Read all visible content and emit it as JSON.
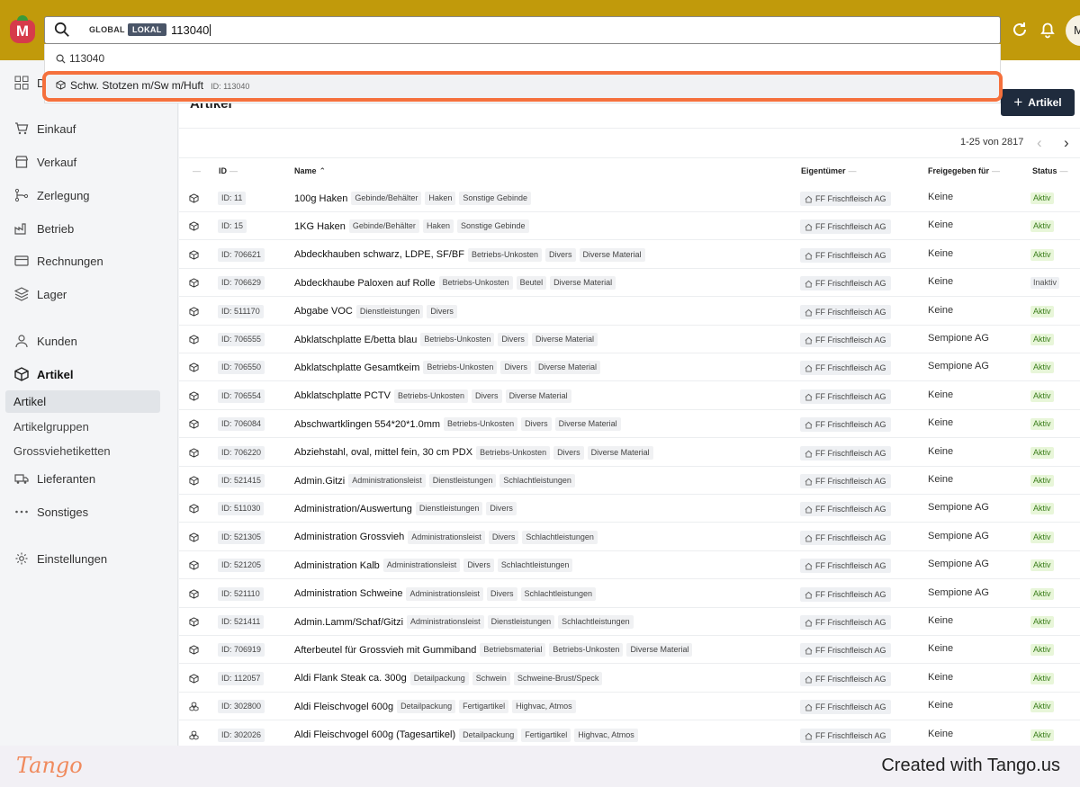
{
  "app": {
    "logo_letter": "M"
  },
  "search": {
    "scope_global": "GLOBAL",
    "scope_lokal": "LOKAL",
    "value": "113040"
  },
  "dropdown": {
    "query_suggestion": "113040",
    "result_name": "Schw. Stotzen m/Sw m/Huft",
    "result_id": "ID: 113040"
  },
  "header": {
    "avatar_initial": "M"
  },
  "sidebar": {
    "partial_top_label": "D",
    "items": [
      {
        "label": "Einkauf",
        "icon": "cart-icon"
      },
      {
        "label": "Verkauf",
        "icon": "store-icon"
      },
      {
        "label": "Zerlegung",
        "icon": "split-icon"
      },
      {
        "label": "Betrieb",
        "icon": "factory-icon"
      },
      {
        "label": "Rechnungen",
        "icon": "invoice-icon"
      },
      {
        "label": "Lager",
        "icon": "stack-icon"
      },
      {
        "label": "Kunden",
        "icon": "person-icon"
      },
      {
        "label": "Artikel",
        "icon": "cube-icon"
      }
    ],
    "sub_items": [
      "Artikel",
      "Artikelgruppen",
      "Grossvieh­etiketten",
      "Lieferanten"
    ],
    "lieferanten": "Lieferanten",
    "sonstiges": "Sonstiges",
    "einstellungen": "Einstellungen"
  },
  "main": {
    "title": "Artikel",
    "add_button": "Artikel",
    "pagination": "1-25 von 2817",
    "columns": {
      "id": "ID",
      "name": "Name",
      "owner": "Eigentümer",
      "released": "Freigegeben für",
      "status": "Status"
    },
    "rows": [
      {
        "id": "ID: 11",
        "name": "100g Haken",
        "tags": [
          "Gebinde/Behälter",
          "Haken",
          "Sonstige Gebinde"
        ],
        "owner": "FF Frischfleisch AG",
        "released": "Keine",
        "status": "Aktiv"
      },
      {
        "id": "ID: 15",
        "name": "1KG Haken",
        "tags": [
          "Gebinde/Behälter",
          "Haken",
          "Sonstige Gebinde"
        ],
        "owner": "FF Frischfleisch AG",
        "released": "Keine",
        "status": "Aktiv"
      },
      {
        "id": "ID: 706621",
        "name": "Abdeckhauben schwarz, LDPE, SF/BF",
        "tags": [
          "Betriebs-Unkosten",
          "Divers",
          "Diverse Material"
        ],
        "owner": "FF Frischfleisch AG",
        "released": "Keine",
        "status": "Aktiv"
      },
      {
        "id": "ID: 706629",
        "name": "Abdeckhaube Paloxen auf Rolle",
        "tags": [
          "Betriebs-Unkosten",
          "Beutel",
          "Diverse Material"
        ],
        "owner": "FF Frischfleisch AG",
        "released": "Keine",
        "status": "Inaktiv"
      },
      {
        "id": "ID: 511170",
        "name": "Abgabe VOC",
        "tags": [
          "Dienstleistungen",
          "Divers"
        ],
        "owner": "FF Frischfleisch AG",
        "released": "Keine",
        "status": "Aktiv"
      },
      {
        "id": "ID: 706555",
        "name": "Abklatschplatte E/betta blau",
        "tags": [
          "Betriebs-Unkosten",
          "Divers",
          "Diverse Material"
        ],
        "owner": "FF Frischfleisch AG",
        "released": "Sempione AG",
        "status": "Aktiv"
      },
      {
        "id": "ID: 706550",
        "name": "Abklatschplatte Gesamtkeim",
        "tags": [
          "Betriebs-Unkosten",
          "Divers",
          "Diverse Material"
        ],
        "owner": "FF Frischfleisch AG",
        "released": "Sempione AG",
        "status": "Aktiv"
      },
      {
        "id": "ID: 706554",
        "name": "Abklatschplatte PCTV",
        "tags": [
          "Betriebs-Unkosten",
          "Divers",
          "Diverse Material"
        ],
        "owner": "FF Frischfleisch AG",
        "released": "Keine",
        "status": "Aktiv"
      },
      {
        "id": "ID: 706084",
        "name": "Abschwartklingen 554*20*1.0mm",
        "tags": [
          "Betriebs-Unkosten",
          "Divers",
          "Diverse Material"
        ],
        "owner": "FF Frischfleisch AG",
        "released": "Keine",
        "status": "Aktiv"
      },
      {
        "id": "ID: 706220",
        "name": "Abziehstahl, oval, mittel fein, 30 cm PDX",
        "tags": [
          "Betriebs-Unkosten",
          "Divers",
          "Diverse Material"
        ],
        "owner": "FF Frischfleisch AG",
        "released": "Keine",
        "status": "Aktiv"
      },
      {
        "id": "ID: 521415",
        "name": "Admin.Gitzi",
        "tags": [
          "Administrationsleist",
          "Dienstleistungen",
          "Schlachtleistungen"
        ],
        "owner": "FF Frischfleisch AG",
        "released": "Keine",
        "status": "Aktiv"
      },
      {
        "id": "ID: 511030",
        "name": "Administration/Auswertung",
        "tags": [
          "Dienstleistungen",
          "Divers"
        ],
        "owner": "FF Frischfleisch AG",
        "released": "Sempione AG",
        "status": "Aktiv"
      },
      {
        "id": "ID: 521305",
        "name": "Administration Grossvieh",
        "tags": [
          "Administrationsleist",
          "Divers",
          "Schlachtleistungen"
        ],
        "owner": "FF Frischfleisch AG",
        "released": "Sempione AG",
        "status": "Aktiv"
      },
      {
        "id": "ID: 521205",
        "name": "Administration Kalb",
        "tags": [
          "Administrationsleist",
          "Divers",
          "Schlachtleistungen"
        ],
        "owner": "FF Frischfleisch AG",
        "released": "Sempione AG",
        "status": "Aktiv"
      },
      {
        "id": "ID: 521110",
        "name": "Administration Schweine",
        "tags": [
          "Administrationsleist",
          "Divers",
          "Schlachtleistungen"
        ],
        "owner": "FF Frischfleisch AG",
        "released": "Sempione AG",
        "status": "Aktiv"
      },
      {
        "id": "ID: 521411",
        "name": "Admin.Lamm/Schaf/Gitzi",
        "tags": [
          "Administrationsleist",
          "Dienstleistungen",
          "Schlachtleistungen"
        ],
        "owner": "FF Frischfleisch AG",
        "released": "Keine",
        "status": "Aktiv"
      },
      {
        "id": "ID: 706919",
        "name": "Afterbeutel für Grossvieh mit Gummiband",
        "tags": [
          "Betriebsmaterial",
          "Betriebs-Unkosten",
          "Diverse Material"
        ],
        "owner": "FF Frischfleisch AG",
        "released": "Keine",
        "status": "Aktiv"
      },
      {
        "id": "ID: 112057",
        "name": "Aldi Flank Steak ca. 300g",
        "tags": [
          "Detailpackung",
          "Schwein",
          "Schweine-Brust/Speck"
        ],
        "owner": "FF Frischfleisch AG",
        "released": "Keine",
        "status": "Aktiv"
      },
      {
        "id": "ID: 302800",
        "name": "Aldi Fleischvogel 600g",
        "tags": [
          "Detailpackung",
          "Fertigartikel",
          "Highvac, Atmos"
        ],
        "owner": "FF Frischfleisch AG",
        "released": "Keine",
        "status": "Aktiv"
      },
      {
        "id": "ID: 302026",
        "name": "Aldi Fleischvogel 600g (Tagesartikel)",
        "tags": [
          "Detailpackung",
          "Fertigartikel",
          "Highvac, Atmos"
        ],
        "owner": "FF Frischfleisch AG",
        "released": "Keine",
        "status": "Aktiv"
      }
    ]
  },
  "footer": {
    "logo": "Tango",
    "credit": "Created with Tango.us"
  },
  "colors": {
    "topbar": "#c19a0b",
    "highlight": "#f5703c",
    "aktiv_bg": "#e8f6d9",
    "button_dark": "#1f2b3d"
  }
}
